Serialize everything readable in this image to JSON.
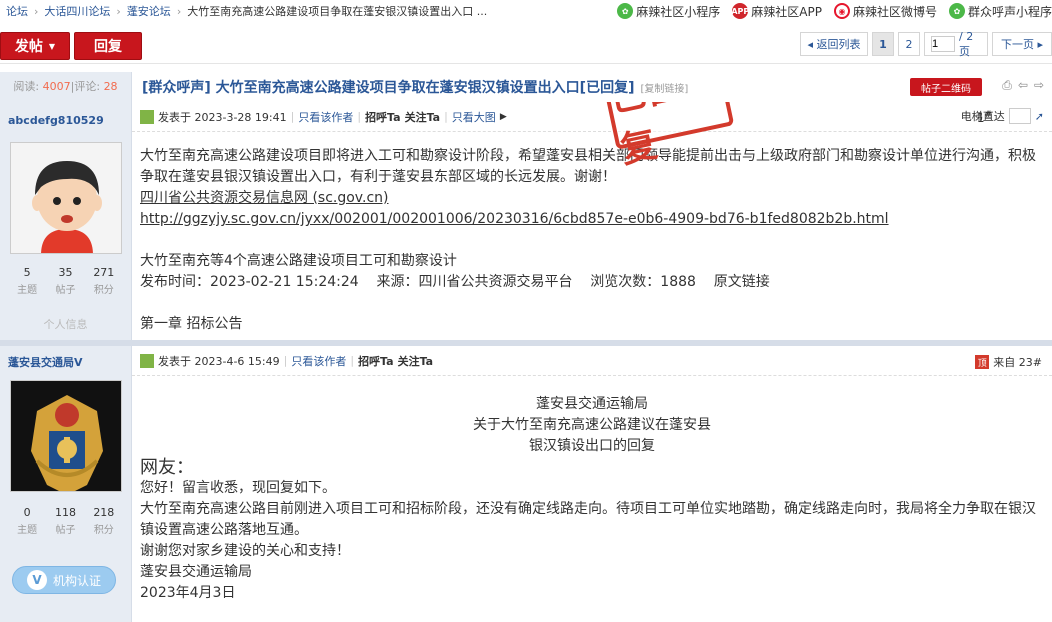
{
  "breadcrumb": [
    "论坛",
    "大话四川论坛",
    "蓬安论坛",
    "大竹至南充高速公路建设项目争取在蓬安银汉镇设置出入口 ..."
  ],
  "top_links": [
    {
      "icon": "wechat-miniprogram-icon",
      "label": "麻辣社区小程序"
    },
    {
      "icon": "app-icon",
      "icon_text": "APP",
      "label": "麻辣社区APP"
    },
    {
      "icon": "weibo-icon",
      "label": "麻辣社区微博号"
    },
    {
      "icon": "wechat-miniprogram-icon",
      "label": "群众呼声小程序"
    }
  ],
  "toolbar": {
    "post_label": "发帖",
    "reply_label": "回复",
    "back_label": "◂ 返回列表",
    "page1": "1",
    "page2": "2",
    "page_input_value": "1",
    "page_total": "/ 2 页",
    "next_label": "下一页 ▸"
  },
  "thread": {
    "views_label": "阅读:",
    "views": "4007",
    "replies_label": "|评论:",
    "replies": "28",
    "title": "[群众呼声] 大竹至南充高速公路建设项目争取在蓬安银汉镇设置出入口[已回复]",
    "copy_link": "[复制链接]",
    "qr_label": "帖子二维码",
    "stamp": "已回复"
  },
  "post1": {
    "username": "abcdefg810529",
    "stats": [
      {
        "n": "5",
        "l": "主题"
      },
      {
        "n": "35",
        "l": "帖子"
      },
      {
        "n": "271",
        "l": "积分"
      }
    ],
    "personal_info_label": "个人信息",
    "published": "发表于 2023-3-28 19:41",
    "only_author": "只看该作者",
    "greet": "招呼Ta",
    "follow": "关注Ta",
    "big_image": "只看大图",
    "floor": "1",
    "floor_sup": "#",
    "elevator": "电梯直达",
    "p1": "大竹至南充高速公路建设项目即将进入工可和勘察设计阶段，希望蓬安县相关部门领导能提前出击与上级政府部门和勘察设计单位进行沟通，积极争取在蓬安县银汉镇设置出入口，有利于蓬安县东部区域的长远发展。谢谢！",
    "link1": "四川省公共资源交易信息网 (sc.gov.cn)",
    "link2": "http://ggzyjy.sc.gov.cn/jyxx/002001/002001006/20230316/6cbd857e-e0b6-4909-bd76-b1fed8082b2b.html",
    "p2": "大竹至南充等4个高速公路建设项目工可和勘察设计",
    "p3": "发布时间：2023-02-21 15:24:24    来源：四川省公共资源交易平台    浏览次数：1888    原文链接",
    "p4": "第一章  招标公告"
  },
  "post2": {
    "username": "蓬安县交通局V",
    "stats": [
      {
        "n": "0",
        "l": "主题"
      },
      {
        "n": "118",
        "l": "帖子"
      },
      {
        "n": "218",
        "l": "积分"
      }
    ],
    "cert_label": "机构认证",
    "published": "发表于 2023-4-6 15:49",
    "only_author": "只看该作者",
    "greet": "招呼Ta",
    "follow": "关注Ta",
    "from_icon": "顶",
    "from_label": "来自 23#",
    "h1": "蓬安县交通运输局",
    "h2": "关于大竹至南充高速公路建议在蓬安县",
    "h3": "银汉镇设出口的回复",
    "greeting": "网友：",
    "l1": "您好！留言收悉，现回复如下。",
    "l2": "大竹至南充高速公路目前刚进入项目工可和招标阶段，还没有确定线路走向。待项目工可单位实地踏勘，确定线路走向时，我局将全力争取在银汉镇设置高速公路落地互通。",
    "l3": "谢谢您对家乡建设的关心和支持！",
    "l4": "蓬安县交通运输局",
    "l5": "2023年4月3日"
  }
}
